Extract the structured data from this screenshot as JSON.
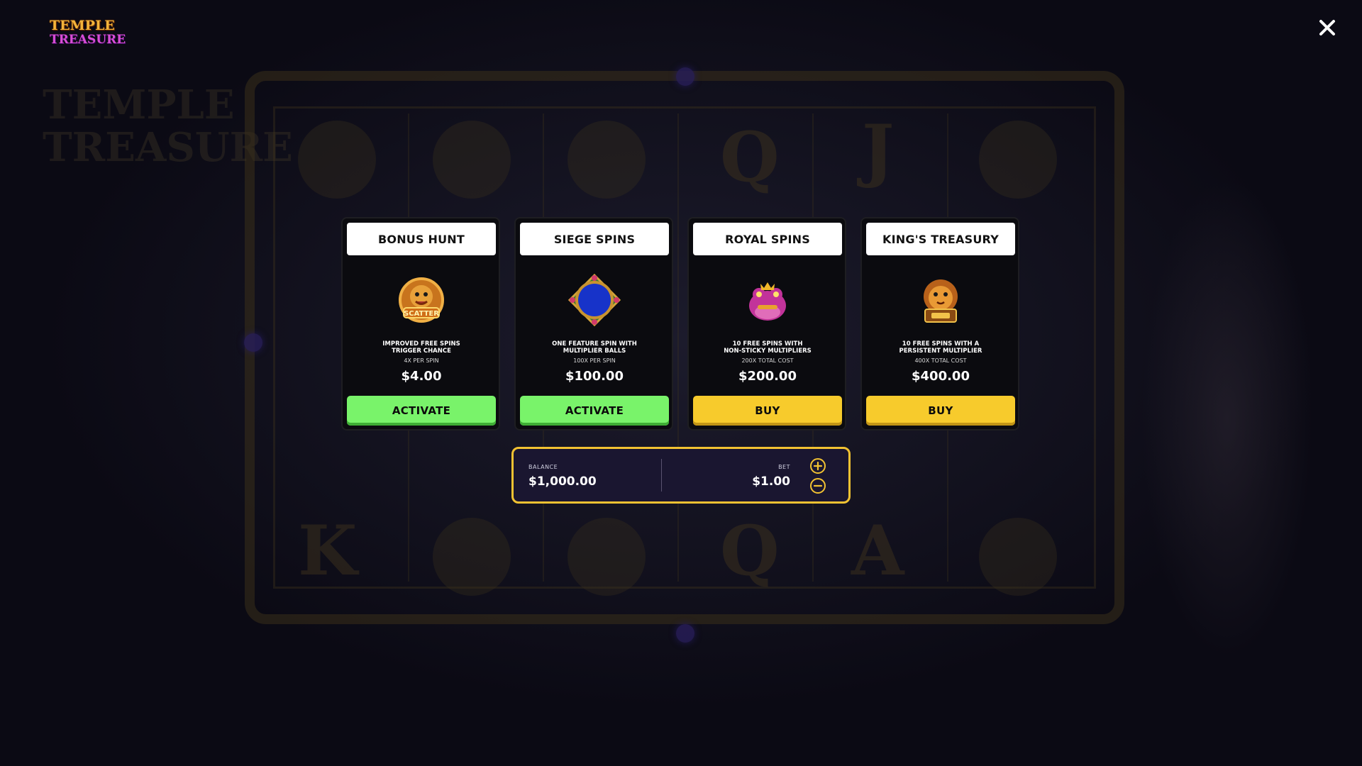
{
  "game": {
    "logo_line1": "TEMPLE",
    "logo_line2": "TREASURE"
  },
  "close_icon": "close-icon",
  "features": [
    {
      "title": "BONUS HUNT",
      "icon": "scatter-lion-icon",
      "description_line1": "IMPROVED FREE SPINS",
      "description_line2": "TRIGGER CHANCE",
      "cost_note": "4X PER SPIN",
      "price": "$4.00",
      "button_label": "ACTIVATE",
      "button_color": "#79f36a"
    },
    {
      "title": "SIEGE SPINS",
      "icon": "multiplier-ball-icon",
      "description_line1": "ONE FEATURE SPIN WITH",
      "description_line2": "MULTIPLIER BALLS",
      "cost_note": "100X PER SPIN",
      "price": "$100.00",
      "button_label": "ACTIVATE",
      "button_color": "#79f36a"
    },
    {
      "title": "ROYAL SPINS",
      "icon": "pink-frog-icon",
      "description_line1": "10 FREE SPINS WITH",
      "description_line2": "NON-STICKY MULTIPLIERS",
      "cost_note": "200X TOTAL COST",
      "price": "$200.00",
      "button_label": "BUY",
      "button_color": "#f7cb2c"
    },
    {
      "title": "KING'S TREASURY",
      "icon": "golden-lion-icon",
      "description_line1": "10 FREE SPINS WITH A",
      "description_line2": "PERSISTENT MULTIPLIER",
      "cost_note": "400X TOTAL COST",
      "price": "$400.00",
      "button_label": "BUY",
      "button_color": "#f7cb2c"
    }
  ],
  "wallet": {
    "balance_label": "BALANCE",
    "balance_value": "$1,000.00",
    "bet_label": "BET",
    "bet_value": "$1.00",
    "increase_icon": "plus-circle-icon",
    "decrease_icon": "minus-circle-icon"
  },
  "colors": {
    "accent_gold": "#f2c232",
    "activate_green": "#79f36a",
    "buy_yellow": "#f7cb2c",
    "panel_bg": "#1a1630"
  }
}
